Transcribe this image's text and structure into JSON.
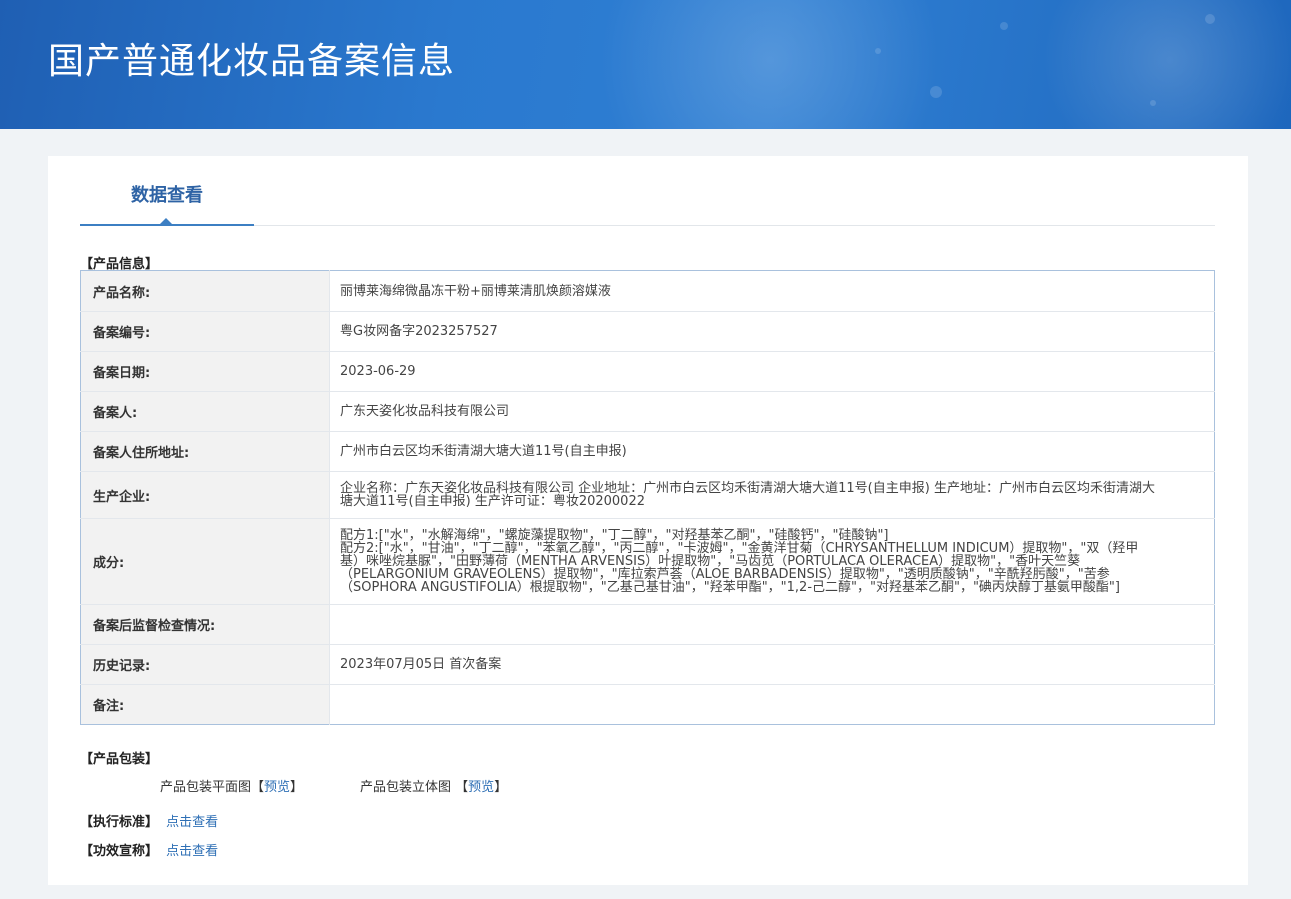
{
  "banner": {
    "title": "国产普通化妆品备案信息"
  },
  "tabs": [
    {
      "label": "数据查看"
    }
  ],
  "product_info": {
    "section_title": "【产品信息】",
    "rows": [
      {
        "key": "产品名称:",
        "value": "丽博莱海绵微晶冻干粉+丽博莱清肌焕颜溶媒液"
      },
      {
        "key": "备案编号:",
        "value": "粤G妆网备字2023257527"
      },
      {
        "key": "备案日期:",
        "value": "2023-06-29"
      },
      {
        "key": "备案人:",
        "value": "广东天姿化妆品科技有限公司"
      },
      {
        "key": "备案人住所地址:",
        "value": "广州市白云区均禾街清湖大塘大道11号(自主申报)"
      },
      {
        "key": "生产企业:",
        "value": "企业名称：广东天姿化妆品科技有限公司 企业地址：广州市白云区均禾街清湖大塘大道11号(自主申报)  生产地址：广州市白云区均禾街清湖大塘大道11号(自主申报)  生产许可证：粤妆20200022"
      },
      {
        "key": "成分:",
        "value": "配方1:[\"水\"，\"水解海绵\"，\"螺旋藻提取物\"，\"丁二醇\"，\"对羟基苯乙酮\"，\"硅酸钙\"，\"硅酸钠\"]\n配方2:[\"水\"，\"甘油\"，\"丁二醇\"，\"苯氧乙醇\"，\"丙二醇\"，\"卡波姆\"，\"金黄洋甘菊（CHRYSANTHELLUM INDICUM）提取物\"，\"双（羟甲基）咪唑烷基脲\"，\"田野薄荷（MENTHA ARVENSIS）叶提取物\"，\"马齿苋（PORTULACA OLERACEA）提取物\"，\"香叶天竺葵（PELARGONIUM GRAVEOLENS）提取物\"，\"库拉索芦荟（ALOE BARBADENSIS）提取物\"，\"透明质酸钠\"，\"辛酰羟肟酸\"，\"苦参（SOPHORA ANGUSTIFOLIA）根提取物\"，\"乙基己基甘油\"，\"羟苯甲酯\"，\"1,2-己二醇\"，\"对羟基苯乙酮\"，\"碘丙炔醇丁基氨甲酸酯\"]"
      },
      {
        "key": "备案后监督检查情况:",
        "value": ""
      },
      {
        "key": "历史记录:",
        "value": "2023年07月05日 首次备案"
      },
      {
        "key": "备注:",
        "value": ""
      }
    ]
  },
  "packaging": {
    "section_title": "【产品包装】",
    "flat_label": "产品包装平面图",
    "flat_bracket_open": "【",
    "flat_link": "预览",
    "flat_bracket_close": "】",
    "stereo_label": "产品包装立体图",
    "stereo_bracket_open": "【",
    "stereo_link": "预览",
    "stereo_bracket_close": "】"
  },
  "standard": {
    "label": "【执行标准】",
    "link": "点击查看"
  },
  "efficacy": {
    "label": "【功效宣称】",
    "link": "点击查看"
  },
  "colors": {
    "banner": "#2a79cf",
    "tab_text": "#2e63a5",
    "link": "#2e6fb5",
    "key_cell_bg": "#f2f2f2",
    "table_border": "#a9c1dd"
  }
}
